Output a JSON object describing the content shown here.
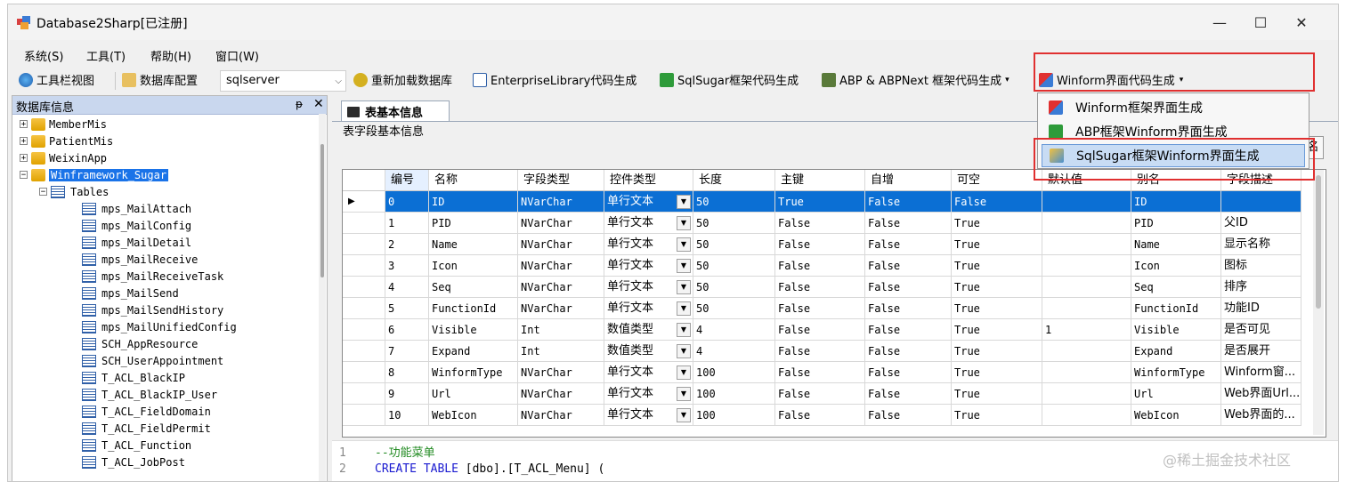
{
  "window": {
    "title": "Database2Sharp[已注册]",
    "buttons": {
      "minimize": "—",
      "maximize": "☐",
      "close": "✕"
    }
  },
  "menubar": [
    "系统(S)",
    "工具(T)",
    "帮助(H)",
    "窗口(W)"
  ],
  "toolbar": {
    "toolbar_view": "工具栏视图",
    "db_config": "数据库配置",
    "db_type": "sqlserver",
    "reload": "重新加载数据库",
    "enterprise": "EnterpriseLibrary代码生成",
    "sqlsugar": "SqlSugar框架代码生成",
    "abp": "ABP & ABPNext 框架代码生成",
    "winform": "Winform界面代码生成"
  },
  "dropdown_menu": [
    "Winform框架界面生成",
    "ABP框架Winform界面生成",
    "SqlSugar框架Winform界面生成"
  ],
  "left_panel": {
    "title": "数据库信息",
    "pin": "ᵽ",
    "close": "✕",
    "databases": [
      "MemberMis",
      "PatientMis",
      "WeixinApp",
      "Winframework_Sugar"
    ],
    "tables_node": "Tables",
    "tables": [
      "mps_MailAttach",
      "mps_MailConfig",
      "mps_MailDetail",
      "mps_MailReceive",
      "mps_MailReceiveTask",
      "mps_MailSend",
      "mps_MailSendHistory",
      "mps_MailUnifiedConfig",
      "SCH_AppResource",
      "SCH_UserAppointment",
      "T_ACL_BlackIP",
      "T_ACL_BlackIP_User",
      "T_ACL_FieldDomain",
      "T_ACL_FieldPermit",
      "T_ACL_Function",
      "T_ACL_JobPost"
    ]
  },
  "tab": {
    "label": "表基本信息",
    "group": "表字段基本信息",
    "side_button": "名"
  },
  "grid": {
    "columns": [
      "编号",
      "名称",
      "字段类型",
      "控件类型",
      "长度",
      "主键",
      "自增",
      "可空",
      "默认值",
      "别名",
      "字段描述"
    ],
    "rows": [
      [
        "0",
        "ID",
        "NVarChar",
        "单行文本",
        "50",
        "True",
        "False",
        "False",
        "",
        "ID",
        ""
      ],
      [
        "1",
        "PID",
        "NVarChar",
        "单行文本",
        "50",
        "False",
        "False",
        "True",
        "",
        "PID",
        "父ID"
      ],
      [
        "2",
        "Name",
        "NVarChar",
        "单行文本",
        "50",
        "False",
        "False",
        "True",
        "",
        "Name",
        "显示名称"
      ],
      [
        "3",
        "Icon",
        "NVarChar",
        "单行文本",
        "50",
        "False",
        "False",
        "True",
        "",
        "Icon",
        "图标"
      ],
      [
        "4",
        "Seq",
        "NVarChar",
        "单行文本",
        "50",
        "False",
        "False",
        "True",
        "",
        "Seq",
        "排序"
      ],
      [
        "5",
        "FunctionId",
        "NVarChar",
        "单行文本",
        "50",
        "False",
        "False",
        "True",
        "",
        "FunctionId",
        "功能ID"
      ],
      [
        "6",
        "Visible",
        "Int",
        "数值类型",
        "4",
        "False",
        "False",
        "True",
        "1",
        "Visible",
        "是否可见"
      ],
      [
        "7",
        "Expand",
        "Int",
        "数值类型",
        "4",
        "False",
        "False",
        "True",
        "",
        "Expand",
        "是否展开"
      ],
      [
        "8",
        "WinformType",
        "NVarChar",
        "单行文本",
        "100",
        "False",
        "False",
        "True",
        "",
        "WinformType",
        "Winform窗..."
      ],
      [
        "9",
        "Url",
        "NVarChar",
        "单行文本",
        "100",
        "False",
        "False",
        "True",
        "",
        "Url",
        "Web界面Url..."
      ],
      [
        "10",
        "WebIcon",
        "NVarChar",
        "单行文本",
        "100",
        "False",
        "False",
        "True",
        "",
        "WebIcon",
        "Web界面的..."
      ]
    ]
  },
  "code": {
    "lines": [
      {
        "num": "1",
        "text": "--功能菜单"
      },
      {
        "num": "2",
        "kw1": "CREATE TABLE",
        "rest": " [dbo].[T_ACL_Menu] ("
      }
    ]
  },
  "watermark": "@稀土掘金技术社区",
  "colors": {
    "selection": "#0b6fd4",
    "highlight_box": "#e03030",
    "panel_header": "#c9d7ee"
  }
}
